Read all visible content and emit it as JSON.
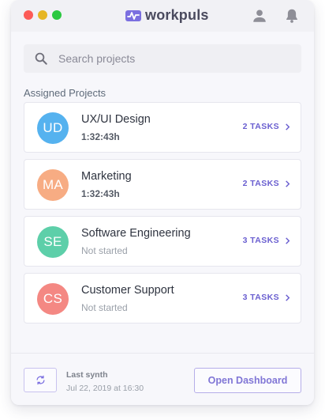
{
  "app": {
    "brand_name": "workpuls"
  },
  "search": {
    "placeholder": "Search projects"
  },
  "projects_section": {
    "title": "Assigned Projects",
    "items": [
      {
        "initials": "UD",
        "name": "UX/UI Design",
        "time": "1:32:43h",
        "tasks": "2 TASKS",
        "avatar_color": "#55b2ef",
        "started": true
      },
      {
        "initials": "MA",
        "name": "Marketing",
        "time": "1:32:43h",
        "tasks": "2 TASKS",
        "avatar_color": "#f7ac83",
        "started": true
      },
      {
        "initials": "SE",
        "name": "Software Engineering",
        "time": "Not started",
        "tasks": "3 TASKS",
        "avatar_color": "#5dcfa9",
        "started": false
      },
      {
        "initials": "CS",
        "name": "Customer Support",
        "time": "Not started",
        "tasks": "3 TASKS",
        "avatar_color": "#f48883",
        "started": false
      }
    ]
  },
  "footer": {
    "sync_label": "Last synth",
    "sync_date": "Jul 22, 2019 at 16:30",
    "dashboard_button": "Open Dashboard"
  },
  "colors": {
    "accent": "#6a5fd0",
    "window_bg": "#f7f7fb"
  }
}
